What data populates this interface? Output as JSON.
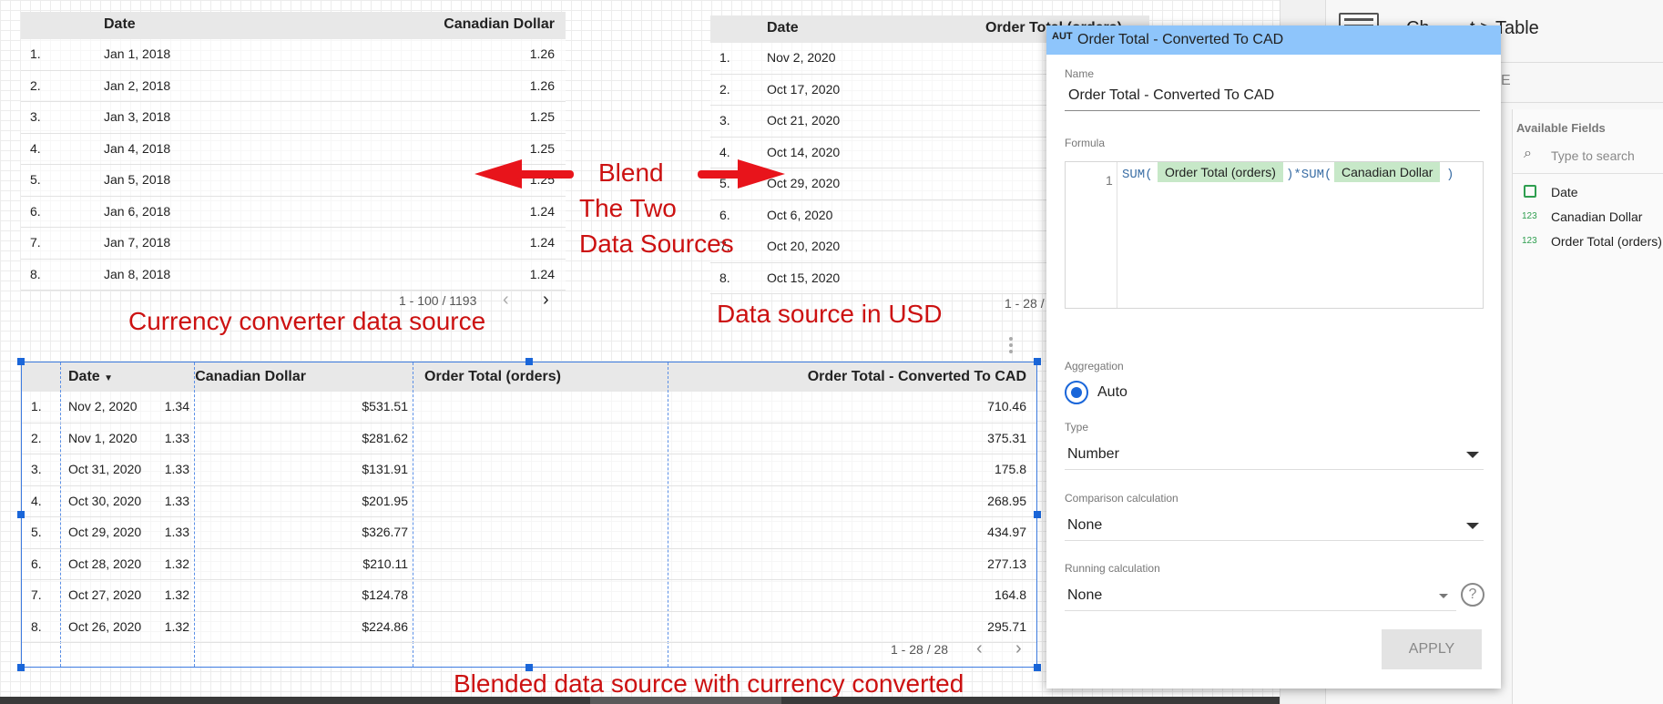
{
  "table1": {
    "headers": [
      "Date",
      "Canadian Dollar"
    ],
    "rows": [
      {
        "n": "1.",
        "date": "Jan 1, 2018",
        "val": "1.26"
      },
      {
        "n": "2.",
        "date": "Jan 2, 2018",
        "val": "1.26"
      },
      {
        "n": "3.",
        "date": "Jan 3, 2018",
        "val": "1.25"
      },
      {
        "n": "4.",
        "date": "Jan 4, 2018",
        "val": "1.25"
      },
      {
        "n": "5.",
        "date": "Jan 5, 2018",
        "val": "1.25"
      },
      {
        "n": "6.",
        "date": "Jan 6, 2018",
        "val": "1.24"
      },
      {
        "n": "7.",
        "date": "Jan 7, 2018",
        "val": "1.24"
      },
      {
        "n": "8.",
        "date": "Jan 8, 2018",
        "val": "1.24"
      }
    ],
    "pager": "1 - 100 / 1193"
  },
  "table2": {
    "headers": [
      "Date",
      "Order Total (orders)"
    ],
    "rows": [
      {
        "n": "1.",
        "date": "Nov 2, 2020"
      },
      {
        "n": "2.",
        "date": "Oct 17, 2020"
      },
      {
        "n": "3.",
        "date": "Oct 21, 2020"
      },
      {
        "n": "4.",
        "date": "Oct 14, 2020"
      },
      {
        "n": "5.",
        "date": "Oct 29, 2020"
      },
      {
        "n": "6.",
        "date": "Oct 6, 2020"
      },
      {
        "n": "7.",
        "date": "Oct 20, 2020"
      },
      {
        "n": "8.",
        "date": "Oct 15, 2020"
      }
    ],
    "pager": "1 - 28 /"
  },
  "annotations": {
    "blend": "Blend",
    "blend2": "The Two",
    "blend3": "Data Sources",
    "currency": "Currency converter data source",
    "usd": "Data source in USD",
    "blended": "Blended data source with currency converted"
  },
  "blended": {
    "headers": {
      "date": "Date",
      "cad": "Canadian Dollar",
      "order": "Order Total (orders)",
      "converted": "Order Total - Converted To CAD"
    },
    "sort_icon": "sort-desc-icon",
    "rows": [
      {
        "n": "1.",
        "date": "Nov 2, 2020",
        "cad": "1.34",
        "order": "$531.51",
        "conv": "710.46"
      },
      {
        "n": "2.",
        "date": "Nov 1, 2020",
        "cad": "1.33",
        "order": "$281.62",
        "conv": "375.31"
      },
      {
        "n": "3.",
        "date": "Oct 31, 2020",
        "cad": "1.33",
        "order": "$131.91",
        "conv": "175.8"
      },
      {
        "n": "4.",
        "date": "Oct 30, 2020",
        "cad": "1.33",
        "order": "$201.95",
        "conv": "268.95"
      },
      {
        "n": "5.",
        "date": "Oct 29, 2020",
        "cad": "1.33",
        "order": "$326.77",
        "conv": "434.97"
      },
      {
        "n": "6.",
        "date": "Oct 28, 2020",
        "cad": "1.32",
        "order": "$210.11",
        "conv": "277.13"
      },
      {
        "n": "7.",
        "date": "Oct 27, 2020",
        "cad": "1.32",
        "order": "$124.78",
        "conv": "164.8"
      },
      {
        "n": "8.",
        "date": "Oct 26, 2020",
        "cad": "1.32",
        "order": "$224.86",
        "conv": "295.71"
      }
    ],
    "pager": "1 - 28 / 28"
  },
  "dialog": {
    "badge": "AUT",
    "title": "Order Total - Converted To CAD",
    "name_label": "Name",
    "name_value": "Order Total - Converted To CAD",
    "formula_label": "Formula",
    "line_no": "1",
    "fn1": "SUM(",
    "chip1": "Order Total (orders)",
    "mid": ")*SUM(",
    "chip2": "Canadian Dollar",
    "close": ")",
    "aggregation_label": "Aggregation",
    "aggregation_value": "Auto",
    "type_label": "Type",
    "type_value": "Number",
    "comparison_label": "Comparison calculation",
    "comparison_value": "None",
    "running_label": "Running calculation",
    "running_value": "None",
    "apply": "APPLY"
  },
  "panel": {
    "chart_label_a": "Ch",
    "chart_label_b": "t > Table",
    "tab_fragment": "E",
    "available_fields": "Available Fields",
    "search_placeholder": "Type to search",
    "fields": [
      {
        "label": "Date",
        "icon": "calendar-icon"
      },
      {
        "label": "Canadian Dollar",
        "icon": "number-icon",
        "type": "123"
      },
      {
        "label": "Order Total (orders)",
        "icon": "number-icon",
        "type": "123"
      }
    ]
  },
  "colors": {
    "accent": "#1a66d9",
    "annotation": "#cc1111",
    "dialog_header": "#8ec5fb",
    "chip": "#c7e8c8"
  }
}
